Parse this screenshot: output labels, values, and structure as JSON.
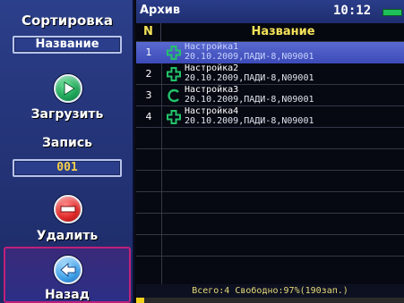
{
  "sidebar": {
    "sort_title": "Сортировка",
    "sort_value": "Название",
    "load_label": "Загрузить",
    "record_title": "Запись",
    "record_value": "001",
    "delete_label": "Удалить",
    "back_label": "Назад"
  },
  "header": {
    "title": "Архив",
    "time": "10:12"
  },
  "table": {
    "columns": [
      "N",
      "Название"
    ],
    "rows": [
      {
        "num": "1",
        "name": "Настройка1",
        "meta": "20.10.2009,ПАДИ-8,N09001",
        "icon": "plus-cross-icon",
        "selected": true
      },
      {
        "num": "2",
        "name": "Настройка2",
        "meta": "20.10.2009,ПАДИ-8,N09001",
        "icon": "plus-cross-icon",
        "selected": false
      },
      {
        "num": "3",
        "name": "Настройка3",
        "meta": "20.10.2009,ПАДИ-8,N09001",
        "icon": "arc-c-icon",
        "selected": false
      },
      {
        "num": "4",
        "name": "Настройка4",
        "meta": "20.10.2009,ПАДИ-8,N09001",
        "icon": "plus-cross-icon",
        "selected": false
      }
    ]
  },
  "status": {
    "text": "Всего:4 Свободно:97%(190зап.)",
    "used_fraction": 0.03
  },
  "colors": {
    "accent_yellow": "#f4e25a",
    "selection": "#4a5ac4",
    "icon_green": "#22c46a",
    "battery": "#1fc05a"
  }
}
